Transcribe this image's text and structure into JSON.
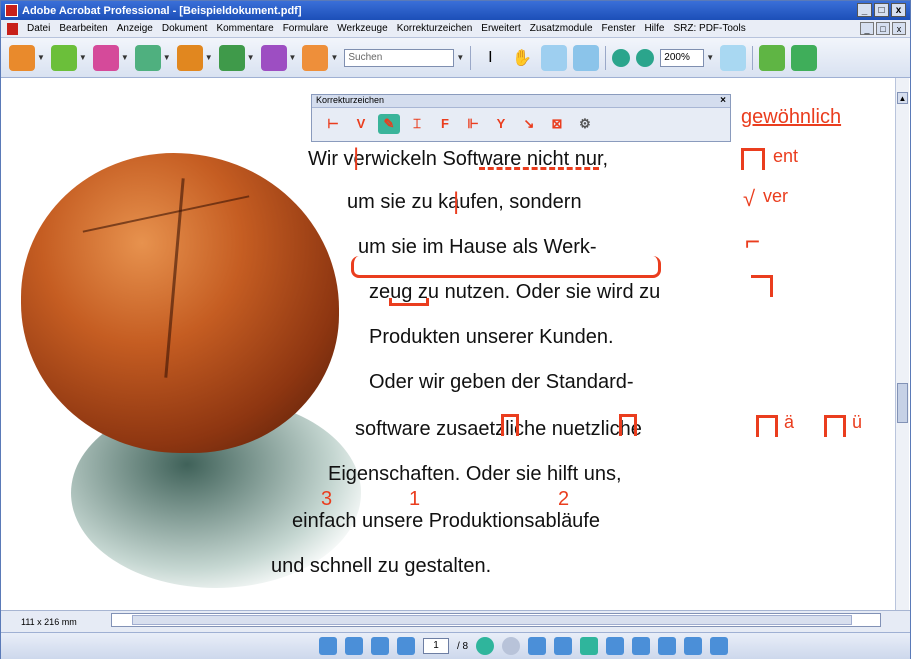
{
  "window": {
    "title": "Adobe Acrobat Professional - [Beispieldokument.pdf]",
    "controls": [
      "_",
      "□",
      "x"
    ]
  },
  "menu": {
    "items": [
      "Datei",
      "Bearbeiten",
      "Anzeige",
      "Dokument",
      "Kommentare",
      "Formulare",
      "Werkzeuge",
      "Korrekturzeichen",
      "Erweitert",
      "Zusatzmodule",
      "Fenster",
      "Hilfe",
      "SRZ: PDF-Tools"
    ]
  },
  "toolbar": {
    "search_placeholder": "Suchen",
    "zoom_value": "200%"
  },
  "palette": {
    "title": "Korrekturzeichen",
    "close": "×"
  },
  "document": {
    "lines": [
      "Wir verwickeln Software nicht nur,",
      "um sie zu kaufen, sondern",
      "um sie im Hause als Werk-",
      "zeug zu nutzen. Oder sie wird zu",
      "Produkten unserer Kunden.",
      "Oder wir geben der Standard-",
      "software zusaetzliche nuetzliche",
      "Eigenschaften. Oder sie hilft uns,",
      "einfach unsere Produktionsabläufe",
      "und schnell zu gestalten."
    ],
    "margin_marks": {
      "top": "gewöhnlich",
      "ent": "ent",
      "ver": "ver",
      "ae": "ä",
      "ue": "ü",
      "num1": "1",
      "num2": "2",
      "num3": "3"
    }
  },
  "status": {
    "page_size": "111 x 216 mm",
    "current_page": "1",
    "total_pages": "/ 8"
  },
  "colors": {
    "accent": "#ea3d1e",
    "titlebar": "#1c4fb8",
    "palette_active": "#3ab49a"
  }
}
